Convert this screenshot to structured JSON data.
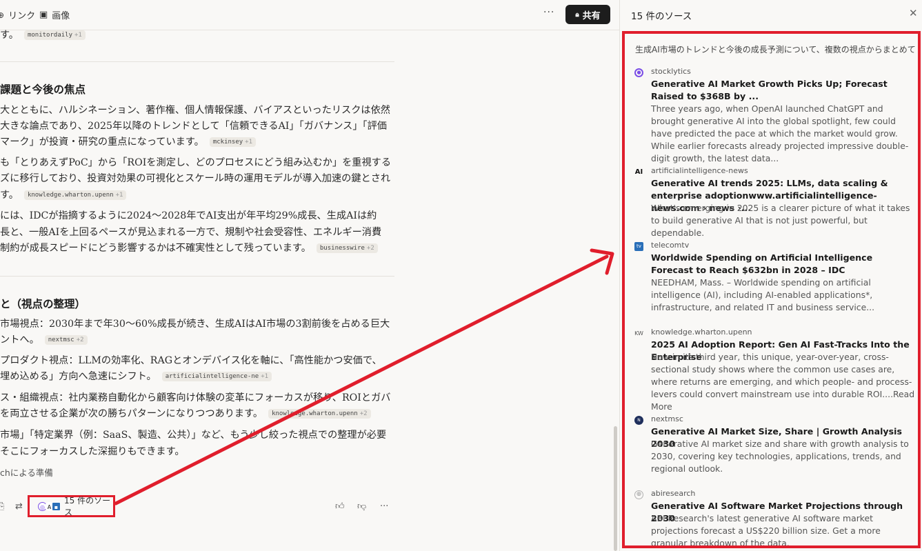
{
  "topbar": {
    "link_label": "リンク",
    "image_label": "画像",
    "share_label": "共有",
    "more": "···"
  },
  "main": {
    "top_line": "す。",
    "top_chip": {
      "name": "monitordaily",
      "plus": "+1"
    },
    "section1": {
      "heading": "課題と今後の焦点",
      "lines": [
        "大とともに、ハルシネーション、著作権、個人情報保護、バイアスといったリスクは依然",
        "大きな論点であり、2025年以降のトレンドとして「信頼できるAI」「ガバナンス」「評価",
        "マーク」が投資・研究の重点になっています。",
        "も「とりあえずPoC」から「ROIを測定し、どのプロセスにどう組み込むか」を重視する",
        "ズに移行しており、投資対効果の可視化とスケール時の運用モデルが導入加速の鍵とされ",
        "す。",
        "には、IDCが指摘するように2024〜2028年でAI支出が年平均29%成長、生成AIは約",
        "長と、一般AIを上回るペースが見込まれる一方で、規制や社会受容性、エネルギー消費",
        "制約が成長スピードにどう影響するかは不確実性として残っています。"
      ],
      "chips": [
        {
          "name": "mckinsey",
          "plus": "+1"
        },
        {
          "name": "knowledge.wharton.upenn",
          "plus": "+1"
        },
        {
          "name": "businesswire",
          "plus": "+2"
        }
      ]
    },
    "section2": {
      "heading": "と（視点の整理）",
      "lines": [
        "市場視点：2030年まで年30〜60%成長が続き、生成AIはAI市場の3割前後を占める巨大",
        "ントへ。",
        "プロダクト視点：LLMの効率化、RAGとオンデバイス化を軸に、「高性能かつ安価で、",
        "埋め込める」方向へ急速にシフト。",
        "ス・組織視点：社内業務自動化から顧客向け体験の変革にフォーカスが移り、ROIとガバ",
        "を両立させる企業が次の勝ちパターンになりつつあります。",
        "市場」「特定業界（例：SaaS、製造、公共）」など、もう少し絞った視点での整理が必要",
        "そこにフォーカスした深掘りもできます。"
      ],
      "chips": [
        {
          "name": "nextmsc",
          "plus": "+2"
        },
        {
          "name": "artificialintelligence-ne",
          "plus": "+1"
        },
        {
          "name": "knowledge.wharton.upenn",
          "plus": "+2"
        }
      ]
    },
    "footnote": "chによる準備",
    "sources_button": "15 件のソース"
  },
  "panel": {
    "title": "15 件のソース",
    "subtitle": "生成AI市場のトレンドと今後の成長予測について、複数の視点からまとめて のソース",
    "sources": [
      {
        "site": "stocklytics",
        "icon": "stocklytics-icon",
        "color": "#7b4ee6",
        "title": "Generative AI Market Growth Picks Up; Forecast Raised to $368B by ...",
        "desc": "Three years ago, when OpenAI launched ChatGPT and brought generative AI into the global spotlight, few could have predicted the pace at which the market would grow. While earlier forecasts already projected impressive double-digit growth, the latest data..."
      },
      {
        "site": "artificialintelligence-news",
        "icon": "ai-news-icon",
        "color": "#111111",
        "title": "Generative AI trends 2025: LLMs, data scaling & enterprise adoptionwww.artificialintelligence-news.com › news ›...",
        "desc": "What's emerging in 2025 is a clearer picture of what it takes to build generative AI that is not just powerful, but dependable."
      },
      {
        "site": "telecomtv",
        "icon": "telecomtv-icon",
        "color": "#2a6fb8",
        "title": "Worldwide Spending on Artificial Intelligence Forecast to Reach $632bn in 2028 – IDC",
        "desc": "NEEDHAM, Mass. – Worldwide spending on artificial intelligence (AI), including AI-enabled applications*, infrastructure, and related IT and business service..."
      },
      {
        "site": "knowledge.wharton.upenn",
        "icon": "wharton-icon",
        "color": "#8a8a8a",
        "title": "2025 AI Adoption Report: Gen AI Fast-Tracks Into the Enterprise",
        "desc": "Now in its third year, this unique, year-over-year, cross-sectional study shows where the common use cases are, where returns are emerging, and which people- and process-levers could convert mainstream use into durable ROI....Read More"
      },
      {
        "site": "nextmsc",
        "icon": "nextmsc-icon",
        "color": "#1f2f5c",
        "title": "Generative AI Market Size, Share | Growth Analysis 2030",
        "desc": "Generative AI market size and share with growth analysis to 2030, covering key technologies, applications, trends, and regional outlook."
      },
      {
        "site": "abiresearch",
        "icon": "globe-icon",
        "color": "#b0b0b0",
        "title": "Generative AI Software Market Projections through 2030",
        "desc": "ABI Research's latest generative AI software market projections forecast a US$220 billion size. Get a more granular breakdown of the data."
      }
    ]
  }
}
